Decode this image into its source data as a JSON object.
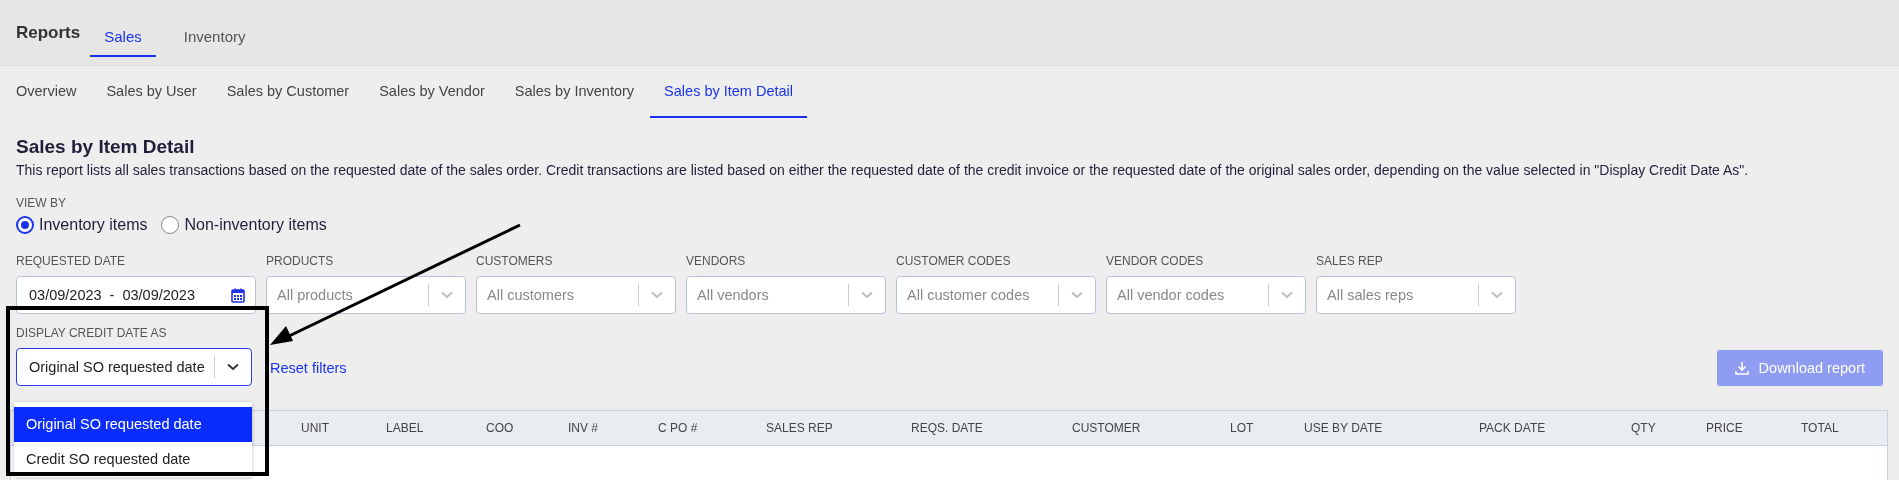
{
  "header": {
    "title": "Reports",
    "tabs": [
      {
        "label": "Sales",
        "selected": true
      },
      {
        "label": "Inventory",
        "selected": false
      }
    ]
  },
  "subtabs": [
    {
      "label": "Overview",
      "selected": false
    },
    {
      "label": "Sales by User",
      "selected": false
    },
    {
      "label": "Sales by Customer",
      "selected": false
    },
    {
      "label": "Sales by Vendor",
      "selected": false
    },
    {
      "label": "Sales by Inventory",
      "selected": false
    },
    {
      "label": "Sales by Item Detail",
      "selected": true
    }
  ],
  "report": {
    "title": "Sales by Item Detail",
    "description": "This report lists all sales transactions based on the requested date of the sales order. Credit transactions are listed based on either the requested date of the credit invoice or the requested date of the original sales order, depending on the value selected in \"Display Credit Date As\"."
  },
  "view_by": {
    "label": "VIEW BY",
    "options": [
      {
        "label": "Inventory items",
        "selected": true
      },
      {
        "label": "Non-inventory items",
        "selected": false
      }
    ]
  },
  "filters": [
    {
      "kind": "daterange",
      "label": "REQUESTED DATE",
      "from": "03/09/2023",
      "separator": "-",
      "to": "03/09/2023"
    },
    {
      "kind": "select",
      "label": "PRODUCTS",
      "placeholder": "All products"
    },
    {
      "kind": "select",
      "label": "CUSTOMERS",
      "placeholder": "All customers"
    },
    {
      "kind": "select",
      "label": "VENDORS",
      "placeholder": "All vendors"
    },
    {
      "kind": "select",
      "label": "CUSTOMER CODES",
      "placeholder": "All customer codes"
    },
    {
      "kind": "select",
      "label": "VENDOR CODES",
      "placeholder": "All vendor codes"
    },
    {
      "kind": "select",
      "label": "SALES REP",
      "placeholder": "All sales reps"
    }
  ],
  "credit_date": {
    "label": "DISPLAY CREDIT DATE AS",
    "value": "Original SO requested date",
    "expanded": true,
    "options": [
      {
        "label": "Original SO requested date",
        "selected": true
      },
      {
        "label": "Credit SO requested date",
        "selected": false
      }
    ]
  },
  "reset_link": "Reset filters",
  "download_button": {
    "label": "Download report",
    "disabled": true
  },
  "table": {
    "columns": [
      "UNIT",
      "LABEL",
      "COO",
      "INV #",
      "C PO #",
      "SALES REP",
      "REQS. DATE",
      "CUSTOMER",
      "LOT",
      "USE BY DATE",
      "PACK DATE",
      "QTY",
      "PRICE",
      "TOTAL"
    ]
  }
}
